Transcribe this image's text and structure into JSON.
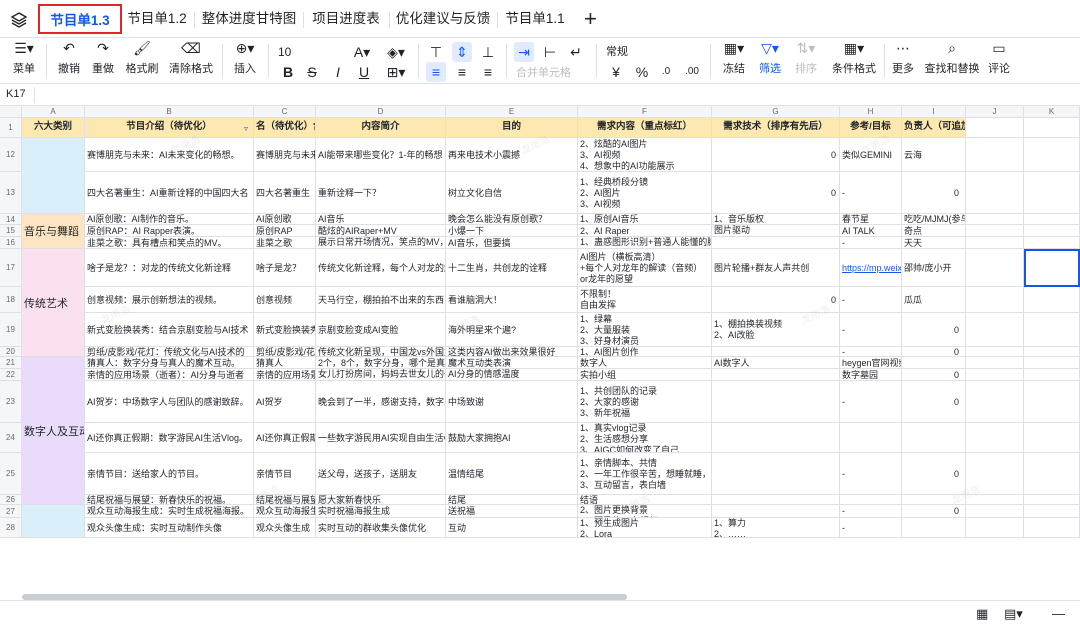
{
  "tabs": [
    {
      "label": "节目单1.3",
      "active": true
    },
    {
      "label": "节目单1.2"
    },
    {
      "label": "整体进度甘特图"
    },
    {
      "label": "项目进度表"
    },
    {
      "label": "优化建议与反馈"
    },
    {
      "label": "节目单1.1"
    }
  ],
  "add_tab": "+",
  "toolbar": {
    "menu": "菜单",
    "undo": "撤销",
    "redo": "重做",
    "format_painter": "格式刷",
    "clear_format": "清除格式",
    "insert": "插入",
    "font_size": "10",
    "merge_cells": "合并单元格",
    "number_format": "常规",
    "yuan": "¥",
    "percent": "%",
    "dec_minus": ".0",
    "dec_plus": ".00",
    "freeze": "冻结",
    "filter": "筛选",
    "sort": "排序",
    "conditional_format": "条件格式",
    "more": "更多",
    "find_replace": "查找和替换",
    "comment": "评论"
  },
  "formula_bar": {
    "cell_ref": "K17"
  },
  "columns": [
    "A",
    "B",
    "C",
    "D",
    "E",
    "F",
    "G",
    "H",
    "I",
    "J",
    "K"
  ],
  "header_row": {
    "num": "1",
    "cells": [
      "六大类别",
      "节目介绍（待优化）",
      "名（待优化）含",
      "内容简介",
      "目的",
      "需求内容（重点标红）",
      "需求技术（排序有先后）",
      "参考/目标",
      "负责人（可追加）",
      "",
      ""
    ]
  },
  "categories": [
    {
      "label": ""
    },
    {
      "label": "音乐与舞蹈"
    },
    {
      "label": "传统艺术"
    },
    {
      "label": "数字人及互动"
    },
    {
      "label": ""
    }
  ],
  "rows": [
    {
      "num": "12",
      "cells": [
        "",
        "赛博朋克与未来：AI未来变化的畅想。",
        "赛博朋克与未来",
        "AI能带来哪些变化？1-年的畅想",
        "再来电技术小震撼",
        [
          "2、炫酷的AI图片",
          "3、AI视频",
          "4、想象中的AI功能展示"
        ],
        "",
        "类似GEMINI",
        "云海",
        "",
        ""
      ],
      "g_num": "0"
    },
    {
      "num": "13",
      "cells": [
        "",
        "四大名著重生：AI重新诠释的中国四大名",
        "四大名著重生",
        "重新诠释一下？",
        "树立文化自信",
        [
          "1、经典桥段分镜",
          "2、AI图片",
          "3、AI视频"
        ],
        "",
        "-",
        "",
        "",
        ""
      ],
      "g_num": "0",
      "i_num": "0"
    },
    {
      "num": "14",
      "cells": [
        "",
        "AI原创歌：AI制作的音乐。",
        "AI原创歌",
        "AI音乐",
        "晚会怎么能没有原创歌？",
        [
          "1、原创AI音乐",
          "2、AI视频（不限格式）"
        ],
        [
          "1、音乐版权",
          "2、AI图片生视频or转绘视频"
        ],
        "春节星",
        "吃吃/MJMJ(参与)",
        "",
        ""
      ]
    },
    {
      "num": "15",
      "cells": [
        "",
        "原创RAP：AI Rapper表演。",
        "原创RAP",
        "酷炫的AIRaper+MV",
        "小爆一下",
        [
          "2、AI Raper"
        ],
        [
          "图片驱动",
          "Runway"
        ],
        "AI TALK",
        "奇点",
        "",
        ""
      ]
    },
    {
      "num": "16",
      "cells": [
        "",
        "韭菜之歌：具有槽点和笑点的MV。",
        "韭菜之歌",
        [
          "展示日常开场情况，笑点的MV，",
          "下一场镰刀挥舞"
        ],
        "AI音乐，但要搞",
        [
          "1、蛊惑图形识别+普通人能懂的脚本",
          "2、AI视频"
        ],
        "",
        "-",
        "天天",
        "",
        ""
      ]
    },
    {
      "num": "17",
      "cells": [
        "",
        "啥子是龙？：对龙的传统文化新诠释",
        "啥子是龙？",
        "传统文化新诠释，每个人对龙的解读",
        "十二生肖，共创龙的诠释",
        [
          "AI图片（横板高清）",
          "+每个人对龙年的解读（音频）",
          "or龙年的愿望"
        ],
        "图片轮播+群友人声共创",
        "https://mp.weixi",
        "邵帅/庞小开",
        "",
        ""
      ]
    },
    {
      "num": "18",
      "cells": [
        "",
        "创意视频：展示创新想法的视频。",
        "创意视频",
        "天马行空，棚拍拍不出来的东西",
        "看谁脑洞大！",
        [
          "不限制！",
          "自由发挥"
        ],
        "",
        "-",
        "瓜瓜",
        "",
        ""
      ],
      "g_num": "0"
    },
    {
      "num": "19",
      "cells": [
        "",
        "新式变脸换装秀：结合京剧变脸与AI技术",
        "新式变脸换装秀",
        "京剧变脸变成AI变脸",
        "海外明星来个遍?",
        [
          "1、绿幕",
          "2、大量服装",
          "3、好身材演员"
        ],
        [
          "1、棚拍换装视频",
          "2、AI改脸"
        ],
        "-",
        "",
        "",
        ""
      ],
      "i_num": "0"
    },
    {
      "num": "20",
      "cells": [
        "",
        "剪纸/皮影戏/花灯：传统文化与AI技术的",
        "剪纸/皮影戏/花灯",
        "传统文化新呈现，中国龙vs外国龙",
        "这类内容AI做出来效果很好",
        [
          "1、AI图片创作",
          "2、AI视频创作"
        ],
        "",
        "-",
        "",
        "",
        ""
      ],
      "i_num": "0"
    },
    {
      "num": "21",
      "cells": [
        "",
        "猜真人：数字分身与真人的魔术互动。",
        "猜真人",
        "2个，8个，数字分身，哪个是真正的",
        "魔术互动类表演",
        "数字人",
        "AI数字人",
        "heygen官网视频",
        "",
        "",
        ""
      ]
    },
    {
      "num": "22",
      "cells": [
        "",
        "亲情的应用场景（逝者）：AI分身与逝者",
        "亲情的应用场景",
        [
          "女儿打扮房间，妈妈去世女儿的一张",
          "音乐对话"
        ],
        [
          "AI分身的情感温度",
          "看看能否越越好"
        ],
        "实拍小组",
        "",
        "数字墓园",
        "",
        "",
        ""
      ],
      "i_num": "0"
    },
    {
      "num": "23",
      "cells": [
        "",
        "AI贺岁：中场数字人与团队的感谢致辞。",
        "AI贺岁",
        "晚会到了一半，感谢支持，数字人与",
        "中场致谢",
        [
          "1、共创团队的记录",
          "2、大家的感谢",
          "3、新年祝福"
        ],
        "",
        "-",
        "",
        "",
        ""
      ],
      "i_num": "0"
    },
    {
      "num": "24",
      "cells": [
        "",
        "AI还你真正假期：数字游民AI生活Vlog。",
        "AI还你真正假期",
        "一些数字游民用AI实现自由生活vlog",
        "鼓励大家拥抱AI",
        [
          "1、真实vlog记录",
          "2、生活感想分享",
          "3、AIGC如何改变了自己"
        ],
        "",
        "",
        "",
        "",
        ""
      ]
    },
    {
      "num": "25",
      "cells": [
        "",
        "亲情节目：送给家人的节目。",
        "亲情节目",
        "送父母，送孩子，送朋友",
        "温情结尾",
        [
          "1、亲情脚本、共情",
          "2、一年工作很辛苦，想睡就睡，想",
          "3、互动留言，表白墙"
        ],
        "",
        "-",
        "",
        "",
        ""
      ],
      "i_num": "0"
    },
    {
      "num": "26",
      "cells": [
        "",
        "结尾祝福与展望：新春快乐的祝福。",
        "结尾祝福与展望",
        "愿大家新春快乐",
        "结尾",
        "结语",
        "",
        "",
        "",
        "",
        ""
      ]
    },
    {
      "num": "27",
      "cells": [
        "",
        "观众互动海报生成：实时生成祝福海报。",
        "观众互动海报生成",
        "实时祝福海报生成",
        "送祝福",
        [
          "2、图片更换背景",
          "3、预录的10条视频"
        ],
        "",
        "-",
        "",
        "",
        ""
      ],
      "i_num": "0"
    },
    {
      "num": "28",
      "cells": [
        "",
        "观众头像生成：实时互动制作头像",
        "观众头像生成",
        "实时互动的群收集头像优化",
        "互动",
        [
          "1、预生成图片",
          "2、Lora"
        ],
        [
          "1、算力",
          "2、……"
        ],
        "-",
        "",
        "",
        ""
      ]
    }
  ],
  "colors": {
    "active_tab": "#1456f0",
    "tab_highlight": "#e0262a",
    "header_fill": "#fde9b0",
    "cat_blue": "#d9f0fb",
    "cat_orange": "#fde5c4",
    "cat_pink": "#fbe0f0",
    "cat_purple": "#e8dcfa",
    "link": "#1456f0"
  },
  "watermark": "龙雨浩"
}
